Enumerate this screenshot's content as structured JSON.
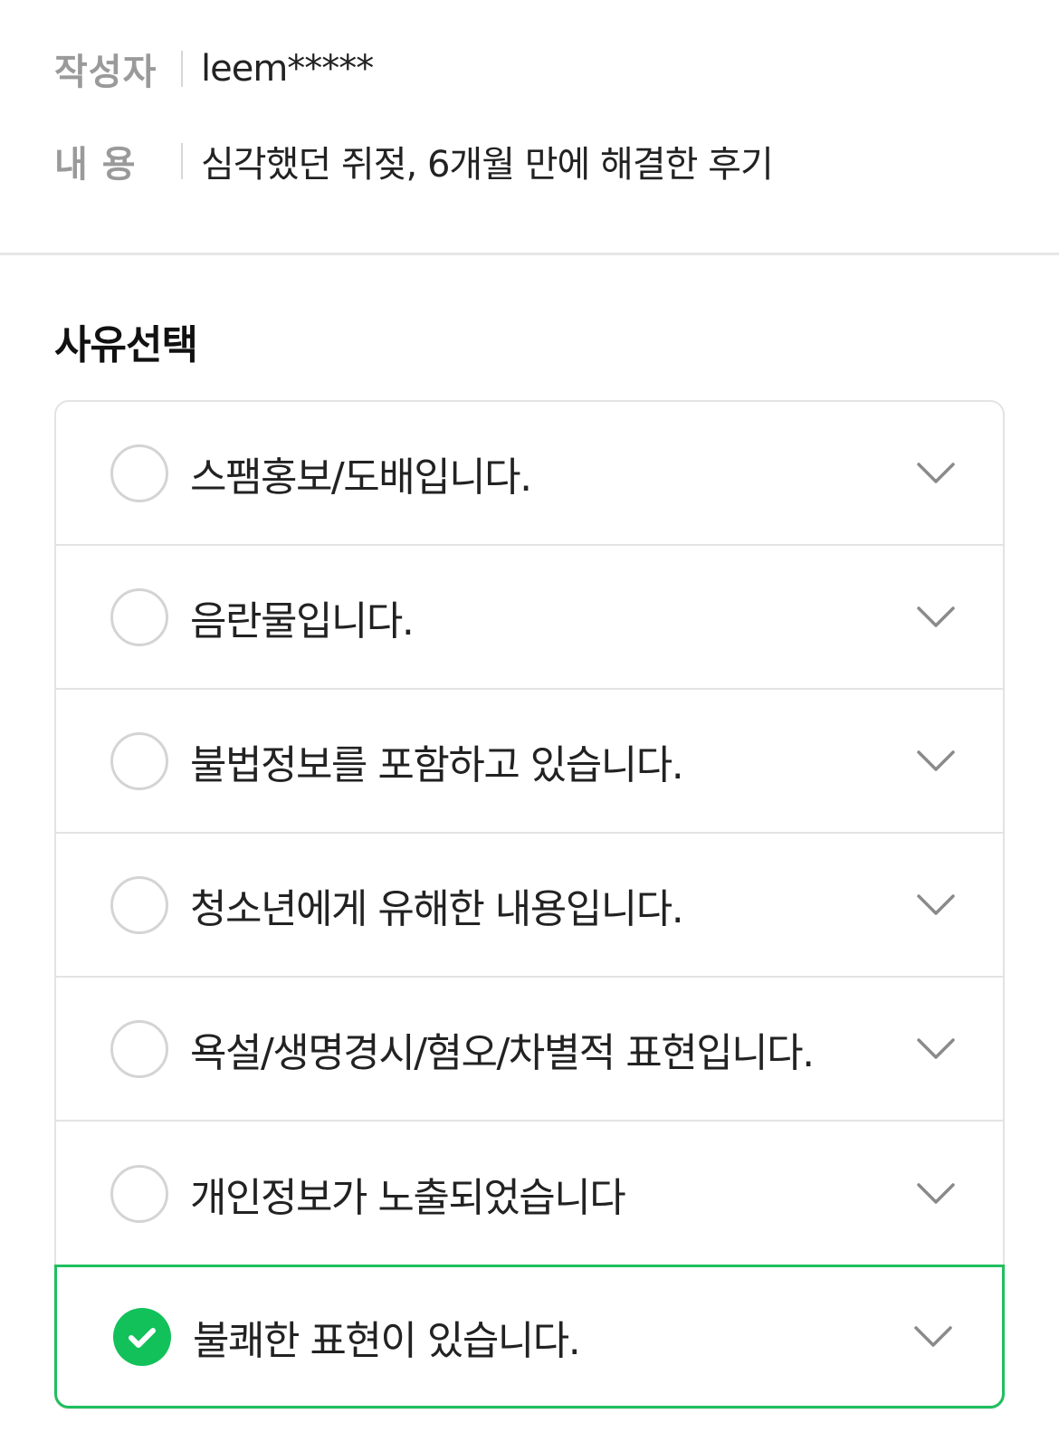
{
  "post_info": {
    "author_label": "작성자",
    "author_value": "leem*****",
    "content_label": "내 용",
    "content_value": "심각했던 쥐젖, 6개월 만에 해결한 후기"
  },
  "reason_section": {
    "title": "사유선택",
    "accent_color": "#12c15a",
    "reasons": [
      {
        "label": "스팸홍보/도배입니다.",
        "selected": false
      },
      {
        "label": "음란물입니다.",
        "selected": false
      },
      {
        "label": "불법정보를 포함하고 있습니다.",
        "selected": false
      },
      {
        "label": "청소년에게 유해한 내용입니다.",
        "selected": false
      },
      {
        "label": "욕설/생명경시/혐오/차별적 표현입니다.",
        "selected": false
      },
      {
        "label": "개인정보가 노출되었습니다",
        "selected": false
      },
      {
        "label": "불쾌한 표현이 있습니다.",
        "selected": true
      }
    ],
    "icons": {
      "radio": "radio-circle-icon",
      "checked": "check-icon",
      "expand": "chevron-down-icon"
    }
  }
}
